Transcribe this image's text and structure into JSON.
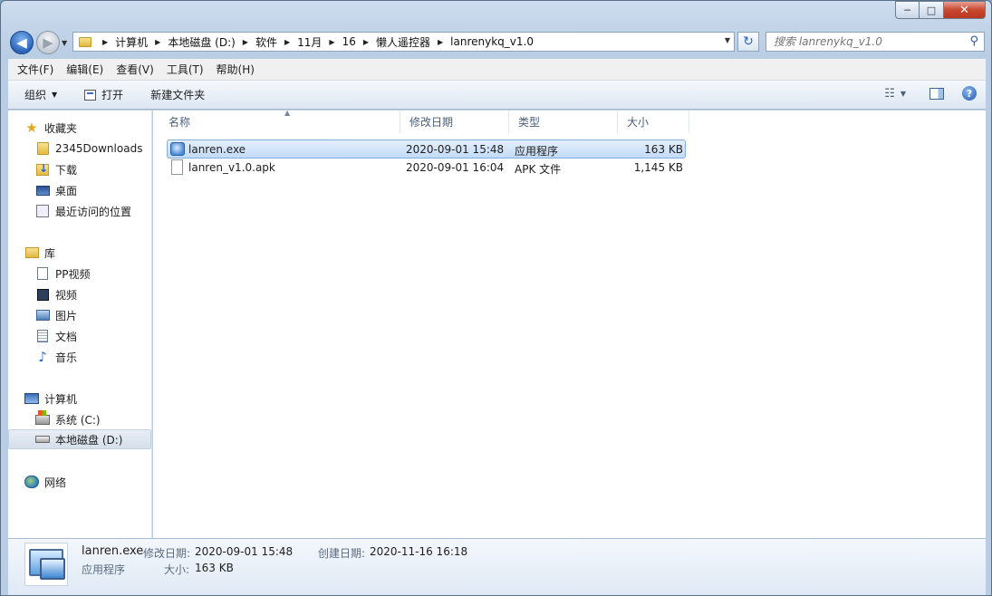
{
  "window": {
    "min_glyph": "─",
    "max_glyph": "□",
    "close_glyph": "✕"
  },
  "nav": {
    "back_glyph": "◀",
    "forward_glyph": "▶",
    "history_glyph": "▼",
    "breadcrumbs": [
      "计算机",
      "本地磁盘 (D:)",
      "软件",
      "11月",
      "16",
      "懒人遥控器",
      "lanrenykq_v1.0"
    ],
    "refresh_glyph": "↻",
    "search_placeholder": "搜索 lanrenykq_v1.0"
  },
  "menubar": [
    "文件(F)",
    "编辑(E)",
    "查看(V)",
    "工具(T)",
    "帮助(H)"
  ],
  "toolbar": {
    "organize": "组织",
    "open": "打开",
    "new_folder": "新建文件夹"
  },
  "sidebar": {
    "favorites": "收藏夹",
    "fav_items": [
      "2345Downloads",
      "下载",
      "桌面",
      "最近访问的位置"
    ],
    "libraries": "库",
    "lib_items": [
      "PP视频",
      "视频",
      "图片",
      "文档",
      "音乐"
    ],
    "computer": "计算机",
    "computer_items": [
      "系统 (C:)",
      "本地磁盘 (D:)"
    ],
    "network": "网络"
  },
  "columns": [
    "名称",
    "修改日期",
    "类型",
    "大小"
  ],
  "files": [
    {
      "name": "lanren.exe",
      "date": "2020-09-01 15:48",
      "type": "应用程序",
      "size": "163 KB"
    },
    {
      "name": "lanren_v1.0.apk",
      "date": "2020-09-01 16:04",
      "type": "APK 文件",
      "size": "1,145 KB"
    }
  ],
  "details": {
    "name": "lanren.exe",
    "modified_label": "修改日期:",
    "modified": "2020-09-01 15:48",
    "created_label": "创建日期:",
    "created": "2020-11-16 16:18",
    "type": "应用程序",
    "size_label": "大小:",
    "size": "163 KB"
  }
}
